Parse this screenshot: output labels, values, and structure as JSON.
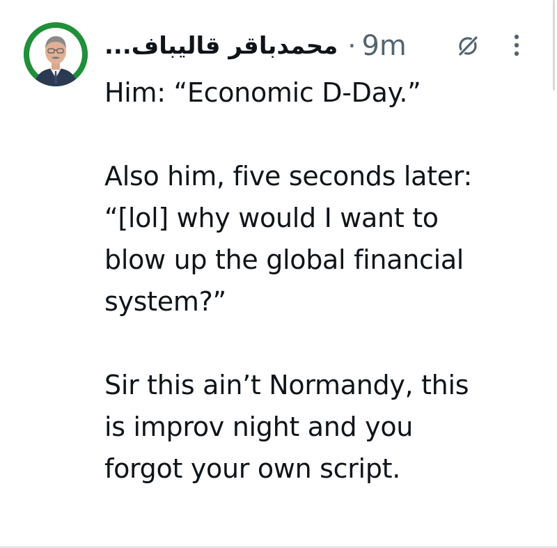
{
  "tweet": {
    "author": {
      "display_name": "محمدباقر قالیباف...",
      "avatar_icon": "profile-photo",
      "avatar_background": "#1f8f3a"
    },
    "separator": "·",
    "timestamp": "9m",
    "grok_icon": "grok-icon",
    "more_icon": "more-vertical-icon",
    "body": {
      "paragraphs": [
        [
          "Him: “Economic D-Day.”"
        ],
        [
          "Also him, five seconds later:",
          "“[lol] why would I want to",
          "blow up the global financial",
          "system?”"
        ],
        [
          "Sir this ain’t Normandy, this",
          "is improv night and you",
          "forgot your own script."
        ]
      ]
    }
  },
  "colors": {
    "text": "#0f1419",
    "secondary": "#536471",
    "divider": "#e7e9ea"
  }
}
